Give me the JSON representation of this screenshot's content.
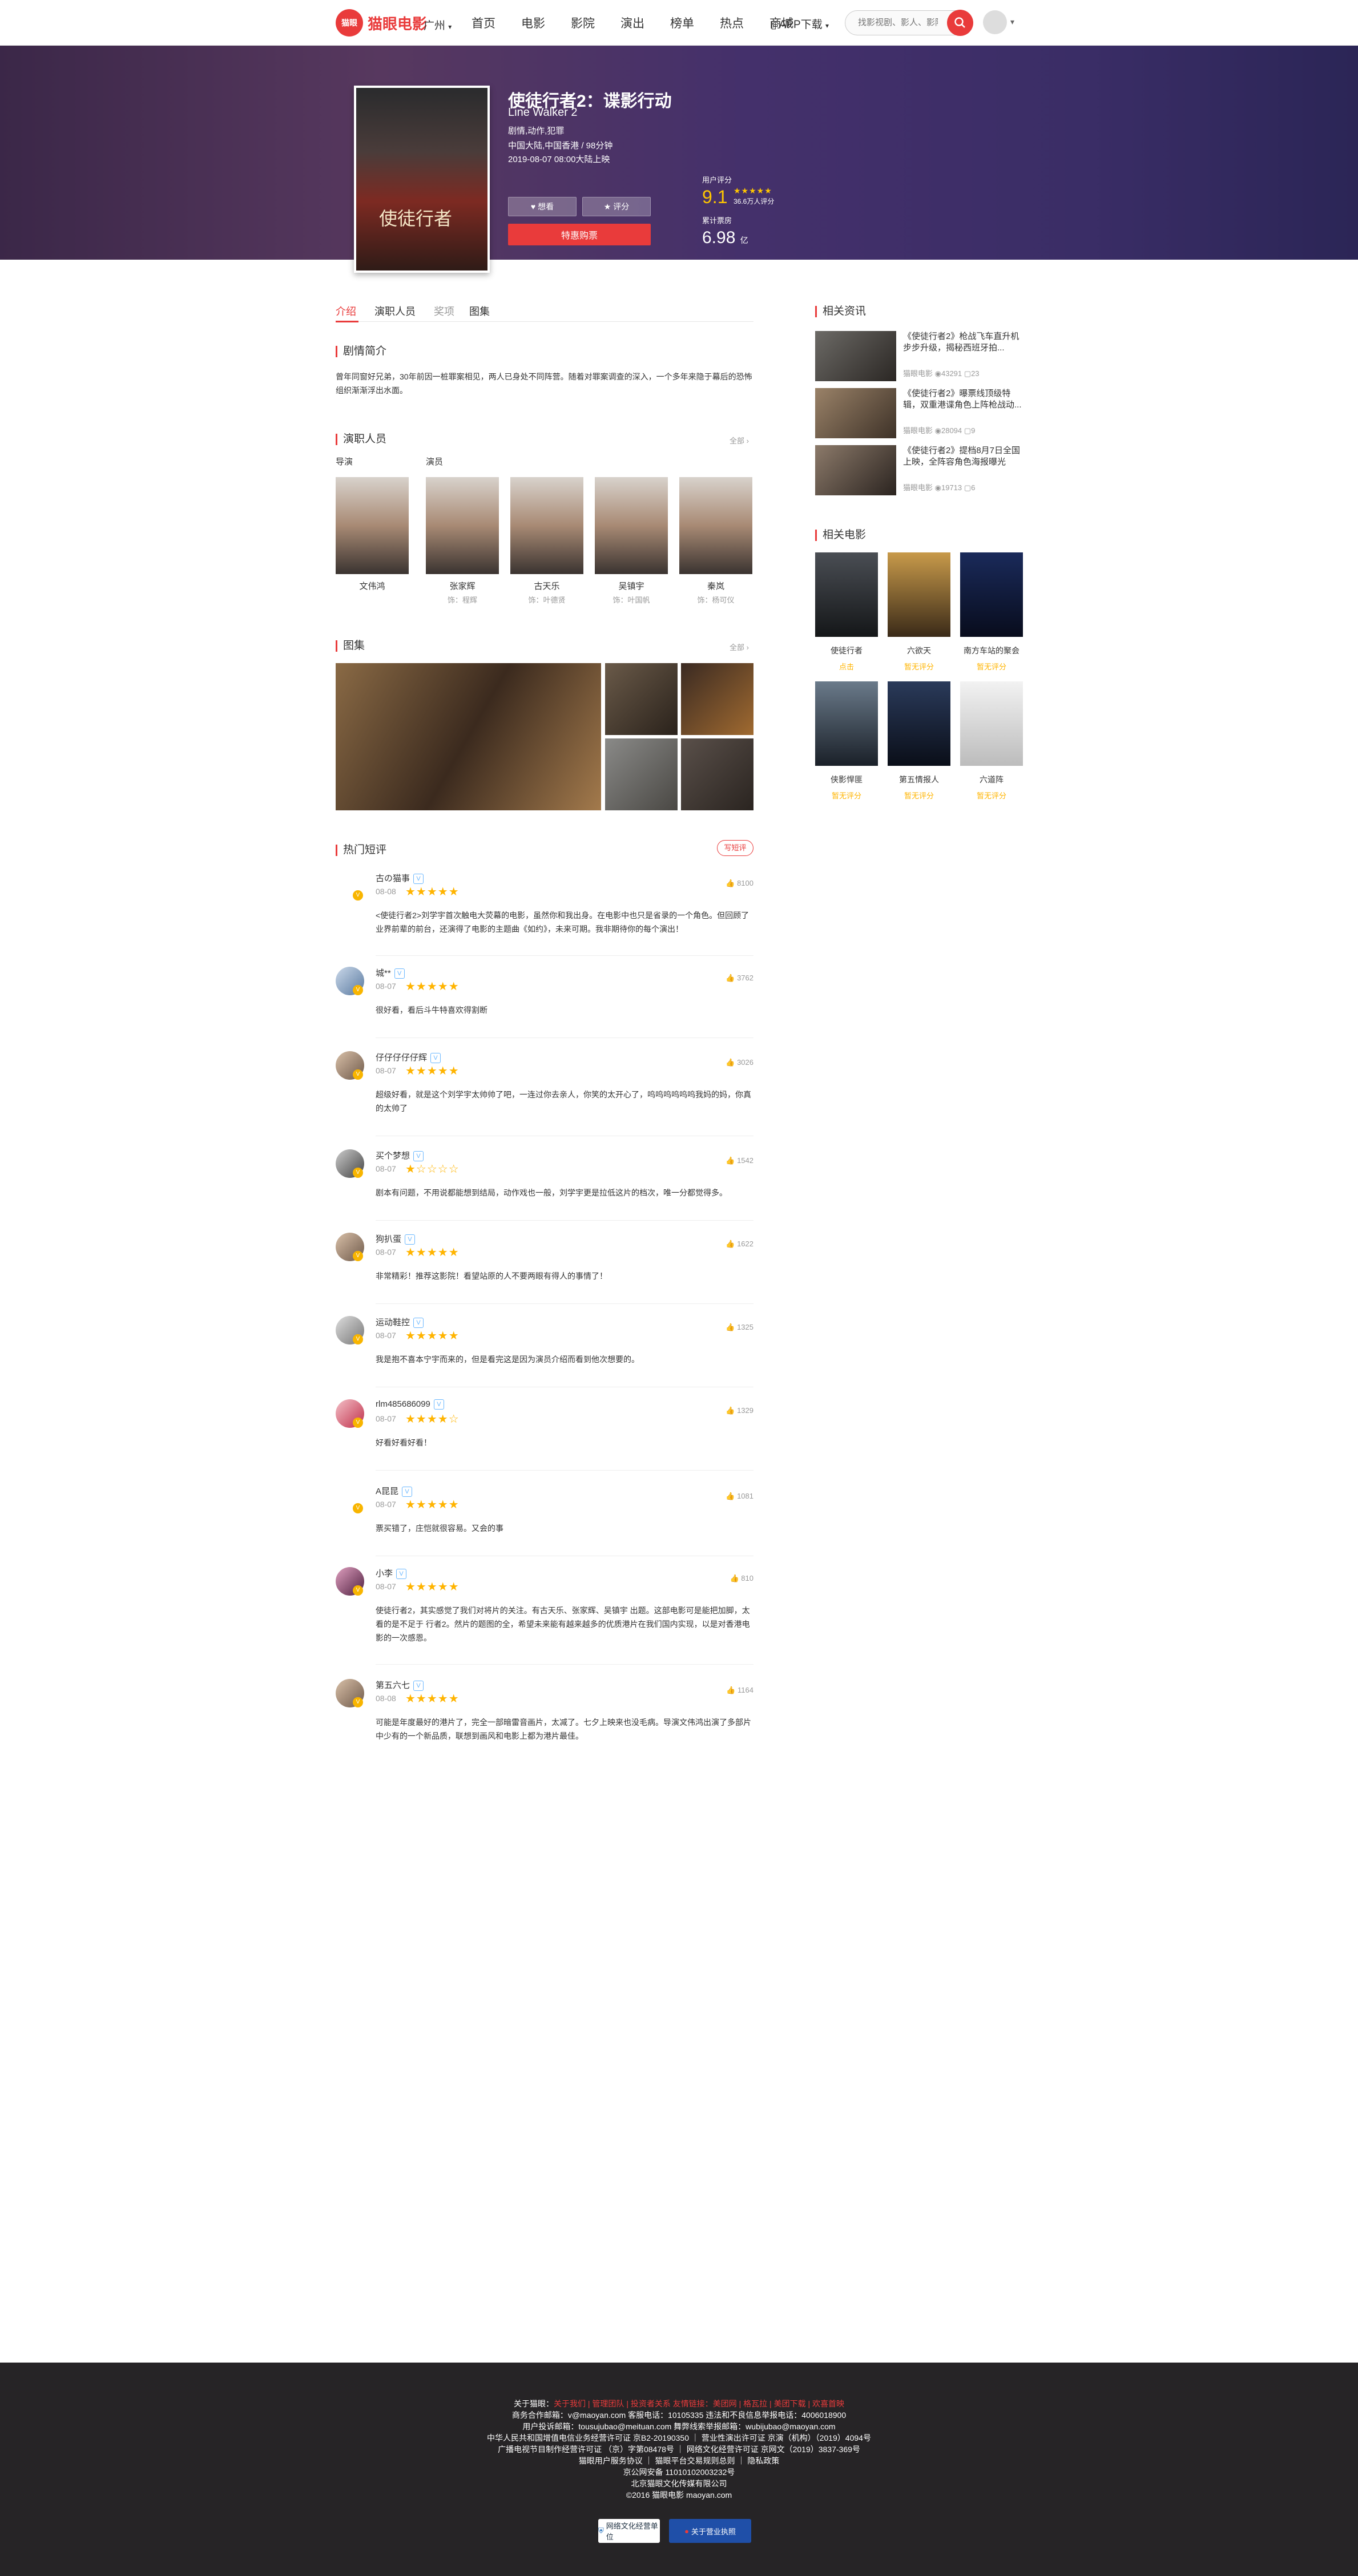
{
  "header": {
    "logo_badge": "猫眼",
    "logo_text": "猫眼电影",
    "city": "广州",
    "nav": [
      "首页",
      "电影",
      "影院",
      "演出",
      "榜单",
      "热点",
      "商城"
    ],
    "app_download": "APP下载",
    "search_placeholder": "找影视剧、影人、影院"
  },
  "movie": {
    "title": "使徒行者2：谍影行动",
    "title_en": "Line Walker 2",
    "genres": "剧情,动作,犯罪",
    "region_duration": "中国大陆,中国香港 / 98分钟",
    "release": "2019-08-07 08:00大陆上映",
    "poster_text": "使徒行者",
    "want_label": "想看",
    "rate_label": "评分",
    "buy_label": "特惠购票",
    "user_rating_label": "用户评分",
    "score": "9.1",
    "rating_count": "36.6万人评分",
    "box_label": "累计票房",
    "box_value": "6.98",
    "box_unit": "亿"
  },
  "tabs": [
    "介绍",
    "演职人员",
    "奖项",
    "图集"
  ],
  "plot": {
    "title": "剧情简介",
    "text": "曾年同窗好兄弟，30年前因一桩罪案相见，两人已身处不同阵营。随着对罪案调查的深入，一个多年来隐于幕后的恐怖组织渐渐浮出水面。"
  },
  "cast": {
    "title": "演职人员",
    "more": "全部",
    "director_label": "导演",
    "actor_label": "演员",
    "people": [
      {
        "name": "文伟鸿",
        "role": ""
      },
      {
        "name": "张家辉",
        "role": "饰：程辉"
      },
      {
        "name": "古天乐",
        "role": "饰：叶德贤"
      },
      {
        "name": "吴镇宇",
        "role": "饰：叶国帆"
      },
      {
        "name": "秦岚",
        "role": "饰：杨可仪"
      }
    ]
  },
  "gallery": {
    "title": "图集",
    "more": "全部"
  },
  "comments": {
    "title": "热门短评",
    "write": "写短评",
    "items": [
      {
        "name": "古の猫事",
        "date": "08-08",
        "stars": "★★★★★",
        "likes": "8100",
        "text": "<使徒行者2>刘学宇首次触电大荧幕的电影，虽然你和我出身。在电影中也只是省录的一个角色。但回顾了业界前辈的前台，还演得了电影的主题曲《如约》，未来可期。我非期待你的每个演出！"
      },
      {
        "name": "城**",
        "date": "08-07",
        "stars": "★★★★★",
        "likes": "3762",
        "text": "很好看，看后斗牛特喜欢得割断"
      },
      {
        "name": "仔仔仔仔仔辉",
        "date": "08-07",
        "stars": "★★★★★",
        "likes": "3026",
        "text": "超级好看，就是这个刘学宇太帅帅了吧，一连过你去亲人，你笑的太开心了，呜呜呜呜呜呜我妈的妈，你真的太帅了"
      },
      {
        "name": "买个梦想",
        "date": "08-07",
        "stars": "★☆☆☆☆",
        "likes": "1542",
        "text": "剧本有问题，不用说都能想到结局，动作戏也一般，刘学宇更是拉低这片的档次，唯一分都觉得多。"
      },
      {
        "name": "狗扒蛋",
        "date": "08-07",
        "stars": "★★★★★",
        "likes": "1622",
        "text": "非常精彩！推荐这影院！看望站原的人不要两眼有得人的事情了！"
      },
      {
        "name": "运动鞋控",
        "date": "08-07",
        "stars": "★★★★★",
        "likes": "1325",
        "text": "我是抱不喜本宁宇而来的，但是看完这是因为演员介绍而看到他次想要的。"
      },
      {
        "name": "rlm485686099",
        "date": "08-07",
        "stars": "★★★★☆",
        "likes": "1329",
        "text": "好看好看好看！"
      },
      {
        "name": "A昆昆",
        "date": "08-07",
        "stars": "★★★★★",
        "likes": "1081",
        "text": "票买错了，庄恺就很容易。又会的事"
      },
      {
        "name": "小李",
        "date": "08-07",
        "stars": "★★★★★",
        "likes": "810",
        "text": "使徒行者2，其实感觉了我们对将片的关注。有古天乐、张家辉、吴镇宇 出题。这部电影可是能把加脚，太看的是不足于 行者2。然片的题图的全，希望未来能有越来越多的优质港片在我们国内实现，以是对香港电影的一次感恩。"
      },
      {
        "name": "第五六七",
        "date": "08-08",
        "stars": "★★★★★",
        "likes": "1164",
        "text": "可能是年度最好的港片了，完全一部暗雷音画片，太减了。七夕上映来也没毛病。导演文伟鸿出演了多部片中少有的一个新品质，联想到画风和电影上都为港片最佳。"
      }
    ]
  },
  "sidebar": {
    "news_title": "相关资讯",
    "news": [
      {
        "title": "《使徒行者2》枪战飞车直升机步步升级，揭秘西班牙拍...",
        "source": "猫眼电影",
        "views": "43291",
        "comments": "23"
      },
      {
        "title": "《使徒行者2》曝票线顶级特辑，双重港谍角色上阵枪战动...",
        "source": "猫眼电影",
        "views": "28094",
        "comments": "9"
      },
      {
        "title": "《使徒行者2》提档8月7日全国上映，全阵容角色海报曝光",
        "source": "猫眼电影",
        "views": "19713",
        "comments": "6"
      }
    ],
    "related_title": "相关电影",
    "related": [
      {
        "name": "使徒行者",
        "score": "点击"
      },
      {
        "name": "六欲天",
        "score": "暂无评分"
      },
      {
        "name": "南方车站的聚会",
        "score": "暂无评分"
      },
      {
        "name": "侠影悍匪",
        "score": "暂无评分"
      },
      {
        "name": "第五情报人",
        "score": "暂无评分"
      },
      {
        "name": "六道阵",
        "score": "暂无评分"
      }
    ]
  },
  "footer": {
    "links_prefix": "关于猫眼：",
    "links": "关于我们 | 管理团队 | 投资者关系    友情链接：美团网 | 格瓦拉 | 美团下载 | 欢喜首映",
    "lines": [
      "商务合作邮箱：v@maoyan.com  客服电话：10105335  违法和不良信息举报电话：4006018900",
      "用户投诉邮箱：tousujubao@meituan.com  舞弊线索举报邮箱：wubijubao@maoyan.com",
      "中华人民共和国增值电信业务经营许可证 京B2-20190350 ｜ 营业性演出许可证 京演（机构）（2019）4094号",
      "广播电视节目制作经营许可证 （京）字第08478号 ｜ 网络文化经营许可证 京网文（2019）3837-369号",
      "猫眼用户服务协议 ｜ 猫眼平台交易规则总则 ｜ 隐私政策",
      "京公网安备 11010102003232号",
      "北京猫眼文化传媒有限公司",
      "©2016 猫眼电影 maoyan.com"
    ],
    "badge1": "网络文化经营单位",
    "badge2": "关于营业执照"
  }
}
